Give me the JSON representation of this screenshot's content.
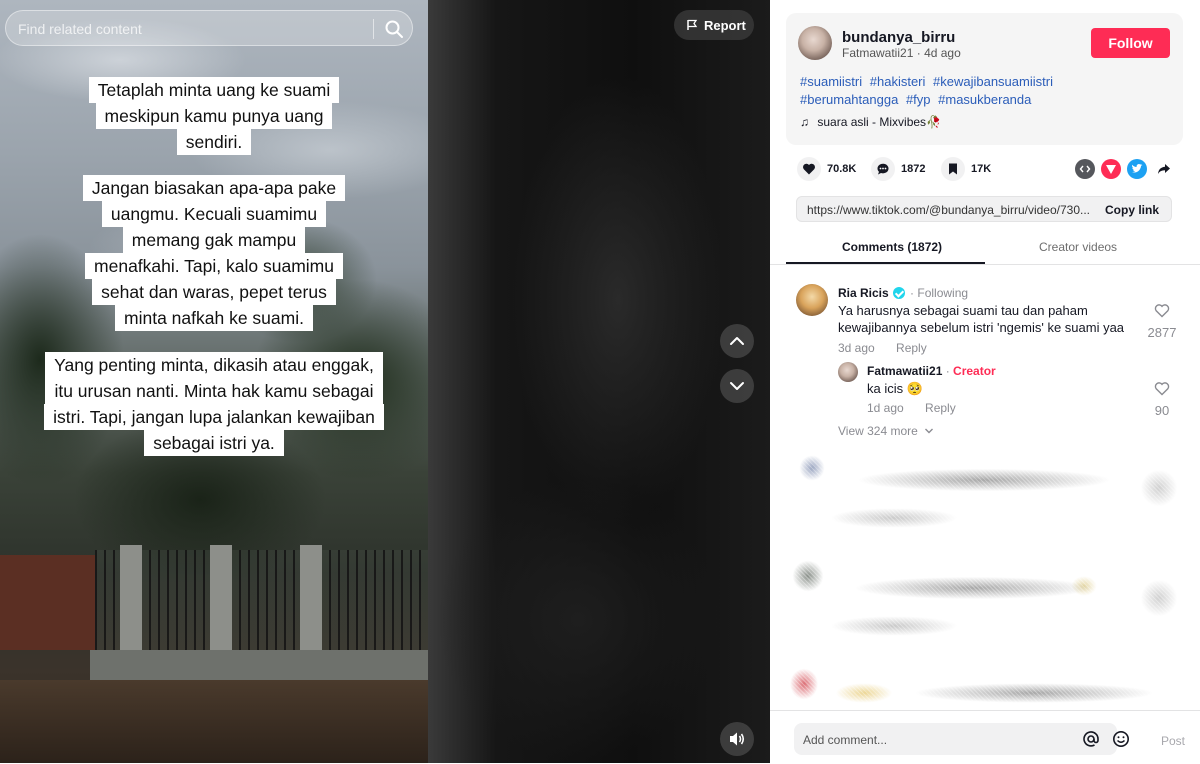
{
  "search": {
    "placeholder": "Find related content"
  },
  "video": {
    "caption_paragraphs": [
      [
        "Tetaplah minta uang ke suami",
        "meskipun kamu punya uang",
        "sendiri."
      ],
      [
        "Jangan biasakan apa-apa pake",
        "uangmu. Kecuali suamimu",
        "memang gak mampu",
        "menafkahi. Tapi, kalo suamimu",
        "sehat dan waras, pepet terus",
        "minta nafkah ke suami."
      ],
      [
        "Yang penting minta, dikasih atau enggak,",
        "itu urusan nanti. Minta hak kamu sebagai",
        "istri. Tapi, jangan lupa jalankan kewajiban",
        "sebagai istri ya."
      ]
    ],
    "report_label": "Report"
  },
  "post": {
    "username": "bundanya_birru",
    "nickname": "Fatmawatii21",
    "age": "4d ago",
    "follow_label": "Follow",
    "hashtags": [
      "#suamiistri",
      "#hakisteri",
      "#kewajibansuamiistri",
      "#berumahtangga",
      "#fyp",
      "#masukberanda"
    ],
    "music": "suara asli - Mixvibes🥀",
    "likes": "70.8K",
    "comments": "1872",
    "saves": "17K",
    "link": "https://www.tiktok.com/@bundanya_birru/video/730...",
    "copy_label": "Copy link"
  },
  "tabs": {
    "comments": "Comments (1872)",
    "creator_videos": "Creator videos"
  },
  "comments": [
    {
      "name": "Ria Ricis",
      "badge": "Following",
      "text": "Ya harusnya sebagai suami tau dan paham kewajibannya sebelum istri 'ngemis' ke suami yaa",
      "time": "3d ago",
      "reply_label": "Reply",
      "likes": "2877"
    }
  ],
  "reply": {
    "name": "Fatmawatii21",
    "separator": " · ",
    "role": "Creator",
    "text": "ka icis 🥺",
    "time": "1d ago",
    "reply_label": "Reply",
    "likes": "90"
  },
  "view_more": "View 324 more",
  "comment_input": {
    "placeholder": "Add comment...",
    "post_label": "Post"
  },
  "colors": {
    "accent": "#fe2c55",
    "hashtag": "#2b5db9",
    "verified": "#20d5ec"
  }
}
